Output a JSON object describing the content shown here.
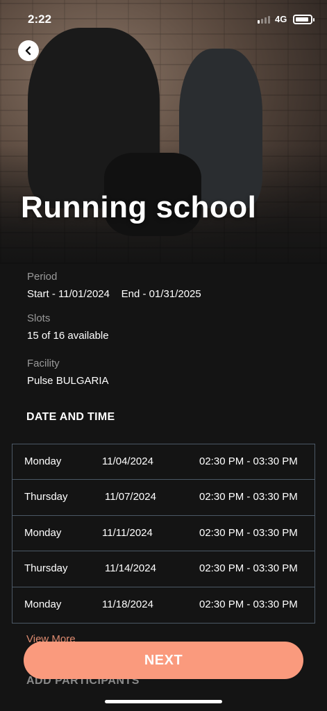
{
  "status_bar": {
    "time": "2:22",
    "network": "4G"
  },
  "hero": {
    "title": "Running school"
  },
  "details": {
    "period_label": "Period",
    "period_value": "Start - 11/01/2024    End - 01/31/2025",
    "slots_label": "Slots",
    "slots_value": "15 of 16 available",
    "facility_label": "Facility",
    "facility_value": "Pulse BULGARIA"
  },
  "schedule": {
    "heading": "DATE AND TIME",
    "rows": [
      {
        "day": "Monday",
        "date": "11/04/2024",
        "time": "02:30 PM - 03:30 PM"
      },
      {
        "day": "Thursday",
        "date": "11/07/2024",
        "time": "02:30 PM - 03:30 PM"
      },
      {
        "day": "Monday",
        "date": "11/11/2024",
        "time": "02:30 PM - 03:30 PM"
      },
      {
        "day": "Thursday",
        "date": "11/14/2024",
        "time": "02:30 PM - 03:30 PM"
      },
      {
        "day": "Monday",
        "date": "11/18/2024",
        "time": "02:30 PM - 03:30 PM"
      }
    ],
    "view_more": "View More"
  },
  "participants": {
    "heading": "ADD PARTICIPANTS"
  },
  "actions": {
    "next_label": "NEXT"
  },
  "colors": {
    "accent": "#fa9a7d",
    "background": "#141414",
    "border": "#4c5866",
    "muted": "#9a9a9a"
  }
}
